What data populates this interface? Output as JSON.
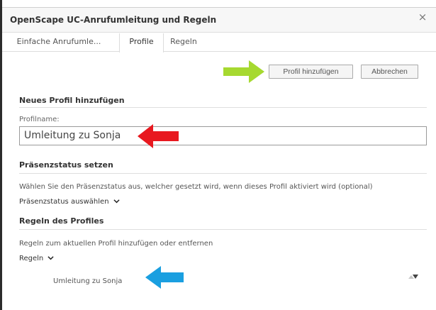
{
  "window": {
    "title": "OpenScape UC-Anrufumleitung und Regeln",
    "close_icon": "close-icon"
  },
  "tabs": [
    {
      "label": "Einfache Anrufumle...",
      "active": false
    },
    {
      "label": "Profile",
      "active": true
    },
    {
      "label": "Regeln",
      "active": false
    }
  ],
  "toolbar": {
    "add_label": "Profil hinzufügen",
    "cancel_label": "Abbrechen"
  },
  "new_profile": {
    "heading": "Neues Profil hinzufügen",
    "name_label": "Profilname:",
    "name_value": "Umleitung zu Sonja"
  },
  "presence": {
    "heading": "Präsenzstatus setzen",
    "description": "Wählen Sie den Präsenzstatus aus, welcher gesetzt wird, wenn dieses Profil aktiviert wird (optional)",
    "select_label": "Präsenzstatus auswählen"
  },
  "rules": {
    "heading": "Regeln des Profiles",
    "description": "Regeln zum aktuellen Profil hinzufügen oder entfernen",
    "dropdown_label": "Regeln",
    "items": [
      "Umleitung zu Sonja"
    ]
  },
  "colors": {
    "annotation_green": "#a6d930",
    "annotation_red": "#e8181f",
    "annotation_blue": "#1a9fe0",
    "window_background": "#ffffff"
  },
  "icons": [
    "close-icon",
    "chevron-down-icon",
    "sort-arrows-icon",
    "green-arrow-annotation",
    "red-arrow-annotation",
    "blue-arrow-annotation"
  ]
}
